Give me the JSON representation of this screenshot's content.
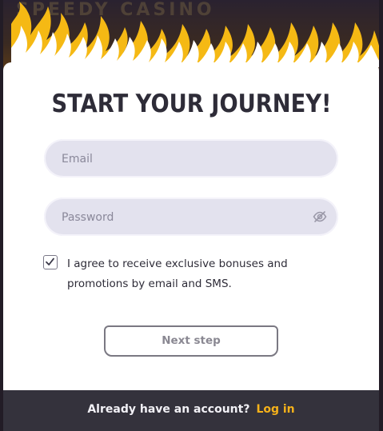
{
  "background": {
    "sign_text": "SPEEDY CASINO"
  },
  "form": {
    "title": "START YOUR JOURNEY!",
    "email_placeholder": "Email",
    "email_value": "",
    "password_placeholder": "Password",
    "password_value": "",
    "consent_checked": true,
    "consent_label": "I agree to receive exclusive bonuses and promotions by email and SMS.",
    "next_label": "Next step"
  },
  "footer": {
    "question": "Already have an account?",
    "login_label": "Log in"
  },
  "colors": {
    "accent": "#f6b21a",
    "flame_yellow": "#f5b914",
    "title": "#2e2c38",
    "input_bg": "#e3e2ee",
    "footer_bg": "#34323c"
  },
  "icons": {
    "password_toggle": "eye-slash-icon",
    "checkbox": "check-icon"
  }
}
